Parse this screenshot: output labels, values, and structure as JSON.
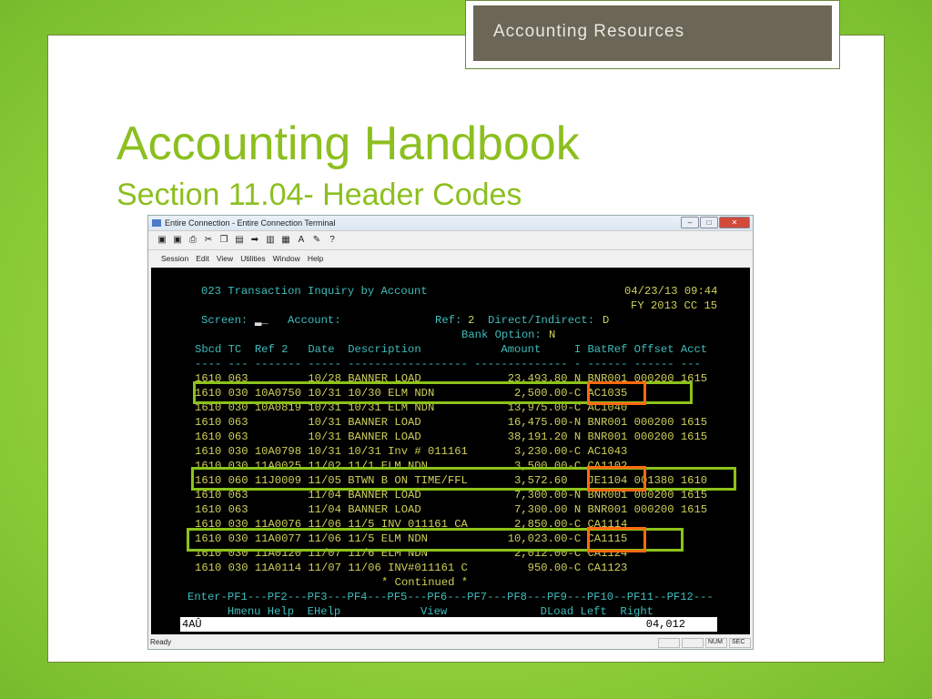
{
  "slide": {
    "header_box": "Accounting Resources",
    "title": "Accounting Handbook",
    "subtitle": "Section 11.04-  Header Codes",
    "accent": "#8cbf1f"
  },
  "window": {
    "title": "Entire Connection - Entire Connection Terminal",
    "menu": [
      "Session",
      "Edit",
      "View",
      "Utilities",
      "Window",
      "Help"
    ],
    "toolbar_icons": [
      "connect-icon",
      "disconnect-icon",
      "print-icon",
      "cut-icon",
      "copy-icon",
      "paste-icon",
      "send-icon",
      "receive-icon",
      "grid-icon",
      "font-icon",
      "color-icon",
      "help-icon"
    ],
    "status": {
      "left": "Ready",
      "num": "NUM",
      "sec": "SEC"
    }
  },
  "terminal": {
    "title": "023 Transaction Inquiry by Account",
    "datetime": "04/23/13 09:44",
    "fy": "FY 2013 CC 15",
    "screen_label": "Screen:",
    "account_label": "Account:",
    "ref_label": "Ref:",
    "ref_value": "2",
    "di_label": "Direct/Indirect:",
    "di_value": "D",
    "bank_label": "Bank Option:",
    "bank_value": "N",
    "columns": [
      "Sbcd",
      "TC",
      "Ref 2",
      "Date",
      "Description",
      "Amount",
      "I",
      "BatRef",
      "Offset",
      "Acct"
    ],
    "rows": [
      [
        "1610",
        "063",
        "",
        "10/28",
        "BANNER LOAD",
        "23,493.80 ",
        "N",
        "BNR001",
        "000200",
        "1615"
      ],
      [
        "1610",
        "030",
        "10A0750",
        "10/31",
        "10/30 ELM NDN",
        "2,500.00-",
        "C",
        "AC1035",
        "",
        ""
      ],
      [
        "1610",
        "030",
        "10A0819",
        "10/31",
        "10/31 ELM NDN",
        "13,975.00-",
        "C",
        "AC1040",
        "",
        ""
      ],
      [
        "1610",
        "063",
        "",
        "10/31",
        "BANNER LOAD",
        "16,475.00-",
        "N",
        "BNR001",
        "000200",
        "1615"
      ],
      [
        "1610",
        "063",
        "",
        "10/31",
        "BANNER LOAD",
        "38,191.20 ",
        "N",
        "BNR001",
        "000200",
        "1615"
      ],
      [
        "1610",
        "030",
        "10A0798",
        "10/31",
        "10/31 Inv # 011161",
        "3,230.00-",
        "C",
        "AC1043",
        "",
        ""
      ],
      [
        "1610",
        "030",
        "11A0025",
        "11/02",
        "11/1 ELM NDN",
        "3,500.00-",
        "C",
        "CA1102",
        "",
        ""
      ],
      [
        "1610",
        "060",
        "11J0009",
        "11/05",
        "BTWN B ON TIME/FFL",
        "3,572.60 ",
        "",
        "JE1104",
        "001380",
        "1610"
      ],
      [
        "1610",
        "063",
        "",
        "11/04",
        "BANNER LOAD",
        "7,300.00-",
        "N",
        "BNR001",
        "000200",
        "1615"
      ],
      [
        "1610",
        "063",
        "",
        "11/04",
        "BANNER LOAD",
        "7,300.00 ",
        "N",
        "BNR001",
        "000200",
        "1615"
      ],
      [
        "1610",
        "030",
        "11A0076",
        "11/06",
        "11/5 INV 011161 CA",
        "2,850.00-",
        "C",
        "CA1114",
        "",
        ""
      ],
      [
        "1610",
        "030",
        "11A0077",
        "11/06",
        "11/5 ELM NDN",
        "10,023.00-",
        "C",
        "CA1115",
        "",
        ""
      ],
      [
        "1610",
        "030",
        "11A0120",
        "11/07",
        "11/6 ELM NDN",
        "2,012.00-",
        "C",
        "CA1124",
        "",
        ""
      ],
      [
        "1610",
        "030",
        "11A0114",
        "11/07",
        "11/06 INV#011161 C",
        "950.00-",
        "C",
        "CA1123",
        "",
        ""
      ]
    ],
    "continued": "* Continued *",
    "pf_line": "Enter-PF1---PF2---PF3---PF4---PF5---PF6---PF7---PF8---PF9---PF10--PF11--PF12---",
    "pf_labels": "      Hmenu Help  EHelp            View              DLoad Left  Right",
    "input_value": "4AÛ",
    "cursor_pos": "04,012"
  },
  "highlight_colors": {
    "row": "#8cc21a",
    "batref": "#ff6a10"
  }
}
